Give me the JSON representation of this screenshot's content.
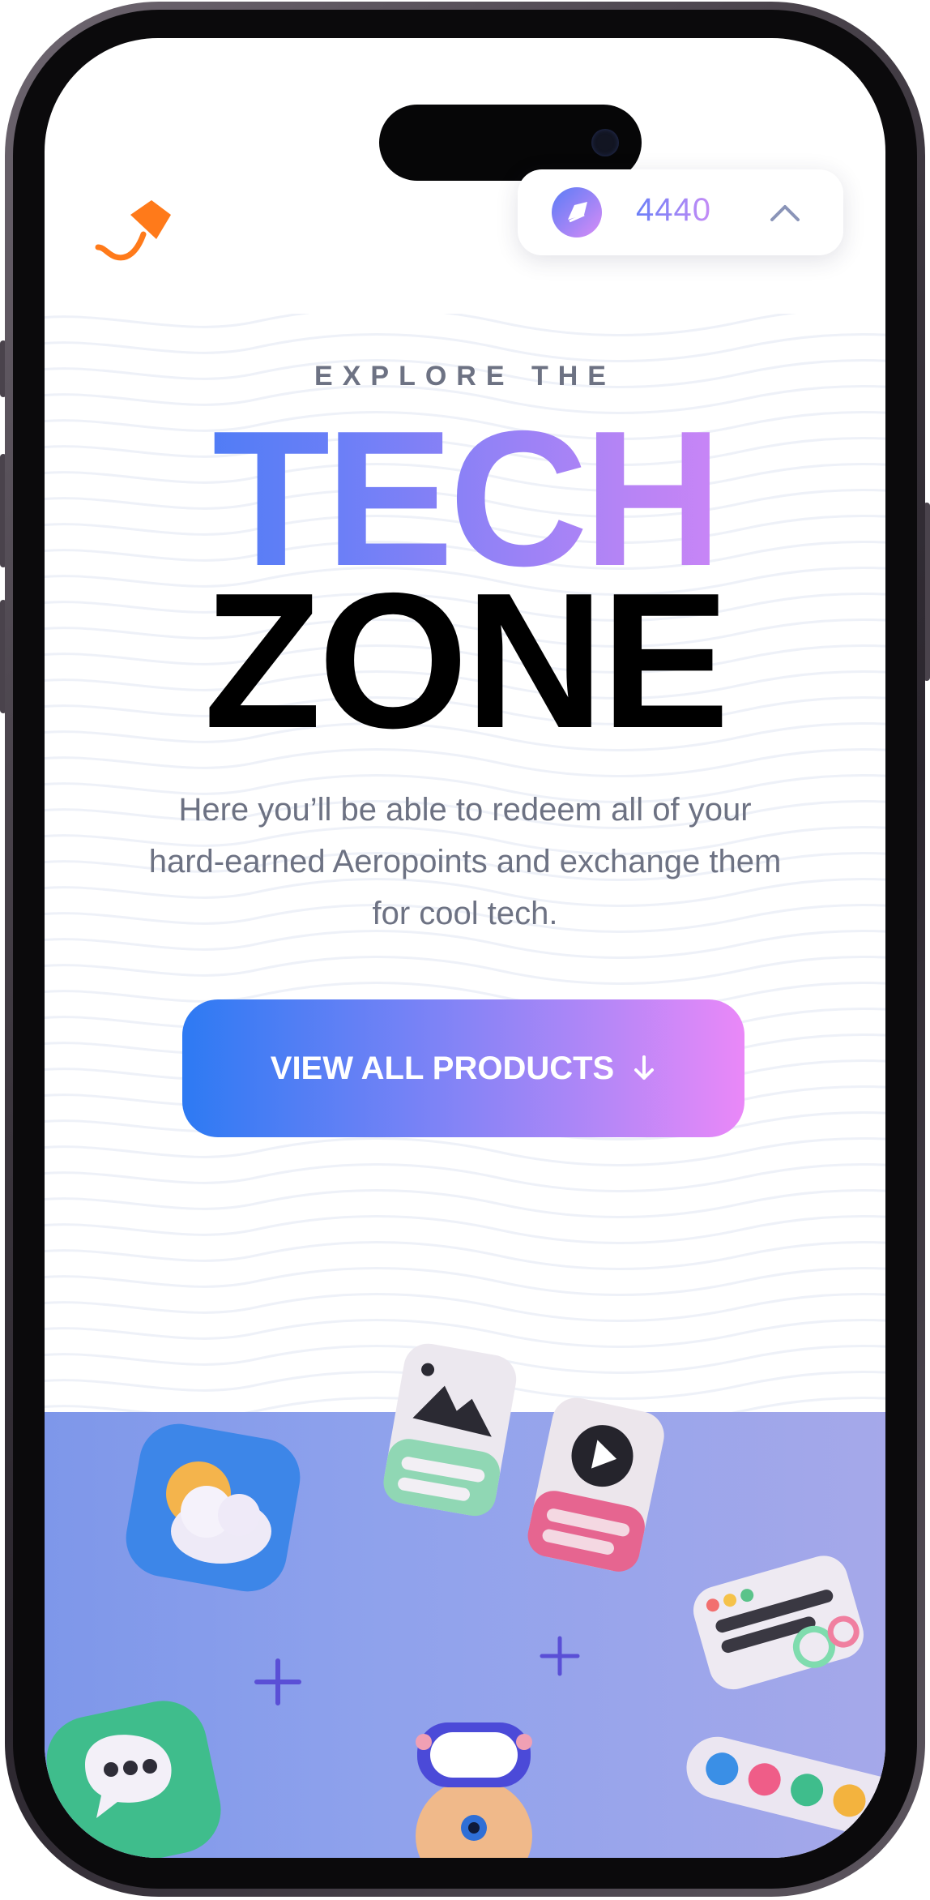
{
  "header": {
    "logo_icon": "kite-logo-icon",
    "points": {
      "value": "4440",
      "icon": "aeropoints-coin-icon",
      "toggle_icon": "chevron-up-icon"
    }
  },
  "hero": {
    "eyebrow": "EXPLORE THE",
    "title_line1": "TECH",
    "title_line2": "ZONE",
    "description": "Here you’ll be able to redeem all of your hard-earned Aeropoints and exchange them for cool tech.",
    "cta_label": "VIEW ALL PRODUCTS",
    "cta_icon": "arrow-down-icon"
  },
  "colors": {
    "brand_gradient_start": "#2e79f3",
    "brand_gradient_end": "#ea88f8",
    "logo_orange": "#ff7a1a",
    "body_text": "#6d7283",
    "band_start": "#7e97ea",
    "band_end": "#a5a8ea"
  },
  "illustration": {
    "icons": [
      "weather-app-icon",
      "image-card-icon",
      "video-card-icon",
      "chat-bubble-icon",
      "vr-headset-character-icon",
      "toggle-card-icon",
      "color-dots-bar-icon",
      "plus-sparkle-icon"
    ]
  }
}
